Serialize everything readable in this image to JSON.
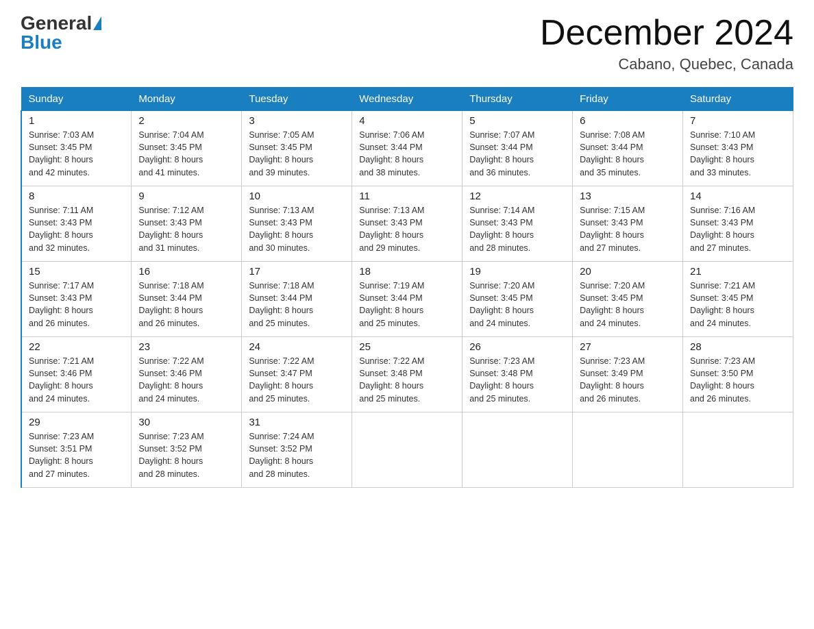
{
  "header": {
    "logo_general": "General",
    "logo_blue": "Blue",
    "title": "December 2024",
    "subtitle": "Cabano, Quebec, Canada"
  },
  "days_of_week": [
    "Sunday",
    "Monday",
    "Tuesday",
    "Wednesday",
    "Thursday",
    "Friday",
    "Saturday"
  ],
  "weeks": [
    [
      {
        "day": "1",
        "sunrise": "7:03 AM",
        "sunset": "3:45 PM",
        "daylight": "8 hours and 42 minutes."
      },
      {
        "day": "2",
        "sunrise": "7:04 AM",
        "sunset": "3:45 PM",
        "daylight": "8 hours and 41 minutes."
      },
      {
        "day": "3",
        "sunrise": "7:05 AM",
        "sunset": "3:45 PM",
        "daylight": "8 hours and 39 minutes."
      },
      {
        "day": "4",
        "sunrise": "7:06 AM",
        "sunset": "3:44 PM",
        "daylight": "8 hours and 38 minutes."
      },
      {
        "day": "5",
        "sunrise": "7:07 AM",
        "sunset": "3:44 PM",
        "daylight": "8 hours and 36 minutes."
      },
      {
        "day": "6",
        "sunrise": "7:08 AM",
        "sunset": "3:44 PM",
        "daylight": "8 hours and 35 minutes."
      },
      {
        "day": "7",
        "sunrise": "7:10 AM",
        "sunset": "3:43 PM",
        "daylight": "8 hours and 33 minutes."
      }
    ],
    [
      {
        "day": "8",
        "sunrise": "7:11 AM",
        "sunset": "3:43 PM",
        "daylight": "8 hours and 32 minutes."
      },
      {
        "day": "9",
        "sunrise": "7:12 AM",
        "sunset": "3:43 PM",
        "daylight": "8 hours and 31 minutes."
      },
      {
        "day": "10",
        "sunrise": "7:13 AM",
        "sunset": "3:43 PM",
        "daylight": "8 hours and 30 minutes."
      },
      {
        "day": "11",
        "sunrise": "7:13 AM",
        "sunset": "3:43 PM",
        "daylight": "8 hours and 29 minutes."
      },
      {
        "day": "12",
        "sunrise": "7:14 AM",
        "sunset": "3:43 PM",
        "daylight": "8 hours and 28 minutes."
      },
      {
        "day": "13",
        "sunrise": "7:15 AM",
        "sunset": "3:43 PM",
        "daylight": "8 hours and 27 minutes."
      },
      {
        "day": "14",
        "sunrise": "7:16 AM",
        "sunset": "3:43 PM",
        "daylight": "8 hours and 27 minutes."
      }
    ],
    [
      {
        "day": "15",
        "sunrise": "7:17 AM",
        "sunset": "3:43 PM",
        "daylight": "8 hours and 26 minutes."
      },
      {
        "day": "16",
        "sunrise": "7:18 AM",
        "sunset": "3:44 PM",
        "daylight": "8 hours and 26 minutes."
      },
      {
        "day": "17",
        "sunrise": "7:18 AM",
        "sunset": "3:44 PM",
        "daylight": "8 hours and 25 minutes."
      },
      {
        "day": "18",
        "sunrise": "7:19 AM",
        "sunset": "3:44 PM",
        "daylight": "8 hours and 25 minutes."
      },
      {
        "day": "19",
        "sunrise": "7:20 AM",
        "sunset": "3:45 PM",
        "daylight": "8 hours and 24 minutes."
      },
      {
        "day": "20",
        "sunrise": "7:20 AM",
        "sunset": "3:45 PM",
        "daylight": "8 hours and 24 minutes."
      },
      {
        "day": "21",
        "sunrise": "7:21 AM",
        "sunset": "3:45 PM",
        "daylight": "8 hours and 24 minutes."
      }
    ],
    [
      {
        "day": "22",
        "sunrise": "7:21 AM",
        "sunset": "3:46 PM",
        "daylight": "8 hours and 24 minutes."
      },
      {
        "day": "23",
        "sunrise": "7:22 AM",
        "sunset": "3:46 PM",
        "daylight": "8 hours and 24 minutes."
      },
      {
        "day": "24",
        "sunrise": "7:22 AM",
        "sunset": "3:47 PM",
        "daylight": "8 hours and 25 minutes."
      },
      {
        "day": "25",
        "sunrise": "7:22 AM",
        "sunset": "3:48 PM",
        "daylight": "8 hours and 25 minutes."
      },
      {
        "day": "26",
        "sunrise": "7:23 AM",
        "sunset": "3:48 PM",
        "daylight": "8 hours and 25 minutes."
      },
      {
        "day": "27",
        "sunrise": "7:23 AM",
        "sunset": "3:49 PM",
        "daylight": "8 hours and 26 minutes."
      },
      {
        "day": "28",
        "sunrise": "7:23 AM",
        "sunset": "3:50 PM",
        "daylight": "8 hours and 26 minutes."
      }
    ],
    [
      {
        "day": "29",
        "sunrise": "7:23 AM",
        "sunset": "3:51 PM",
        "daylight": "8 hours and 27 minutes."
      },
      {
        "day": "30",
        "sunrise": "7:23 AM",
        "sunset": "3:52 PM",
        "daylight": "8 hours and 28 minutes."
      },
      {
        "day": "31",
        "sunrise": "7:24 AM",
        "sunset": "3:52 PM",
        "daylight": "8 hours and 28 minutes."
      },
      null,
      null,
      null,
      null
    ]
  ],
  "labels": {
    "sunrise": "Sunrise:",
    "sunset": "Sunset:",
    "daylight": "Daylight:"
  }
}
